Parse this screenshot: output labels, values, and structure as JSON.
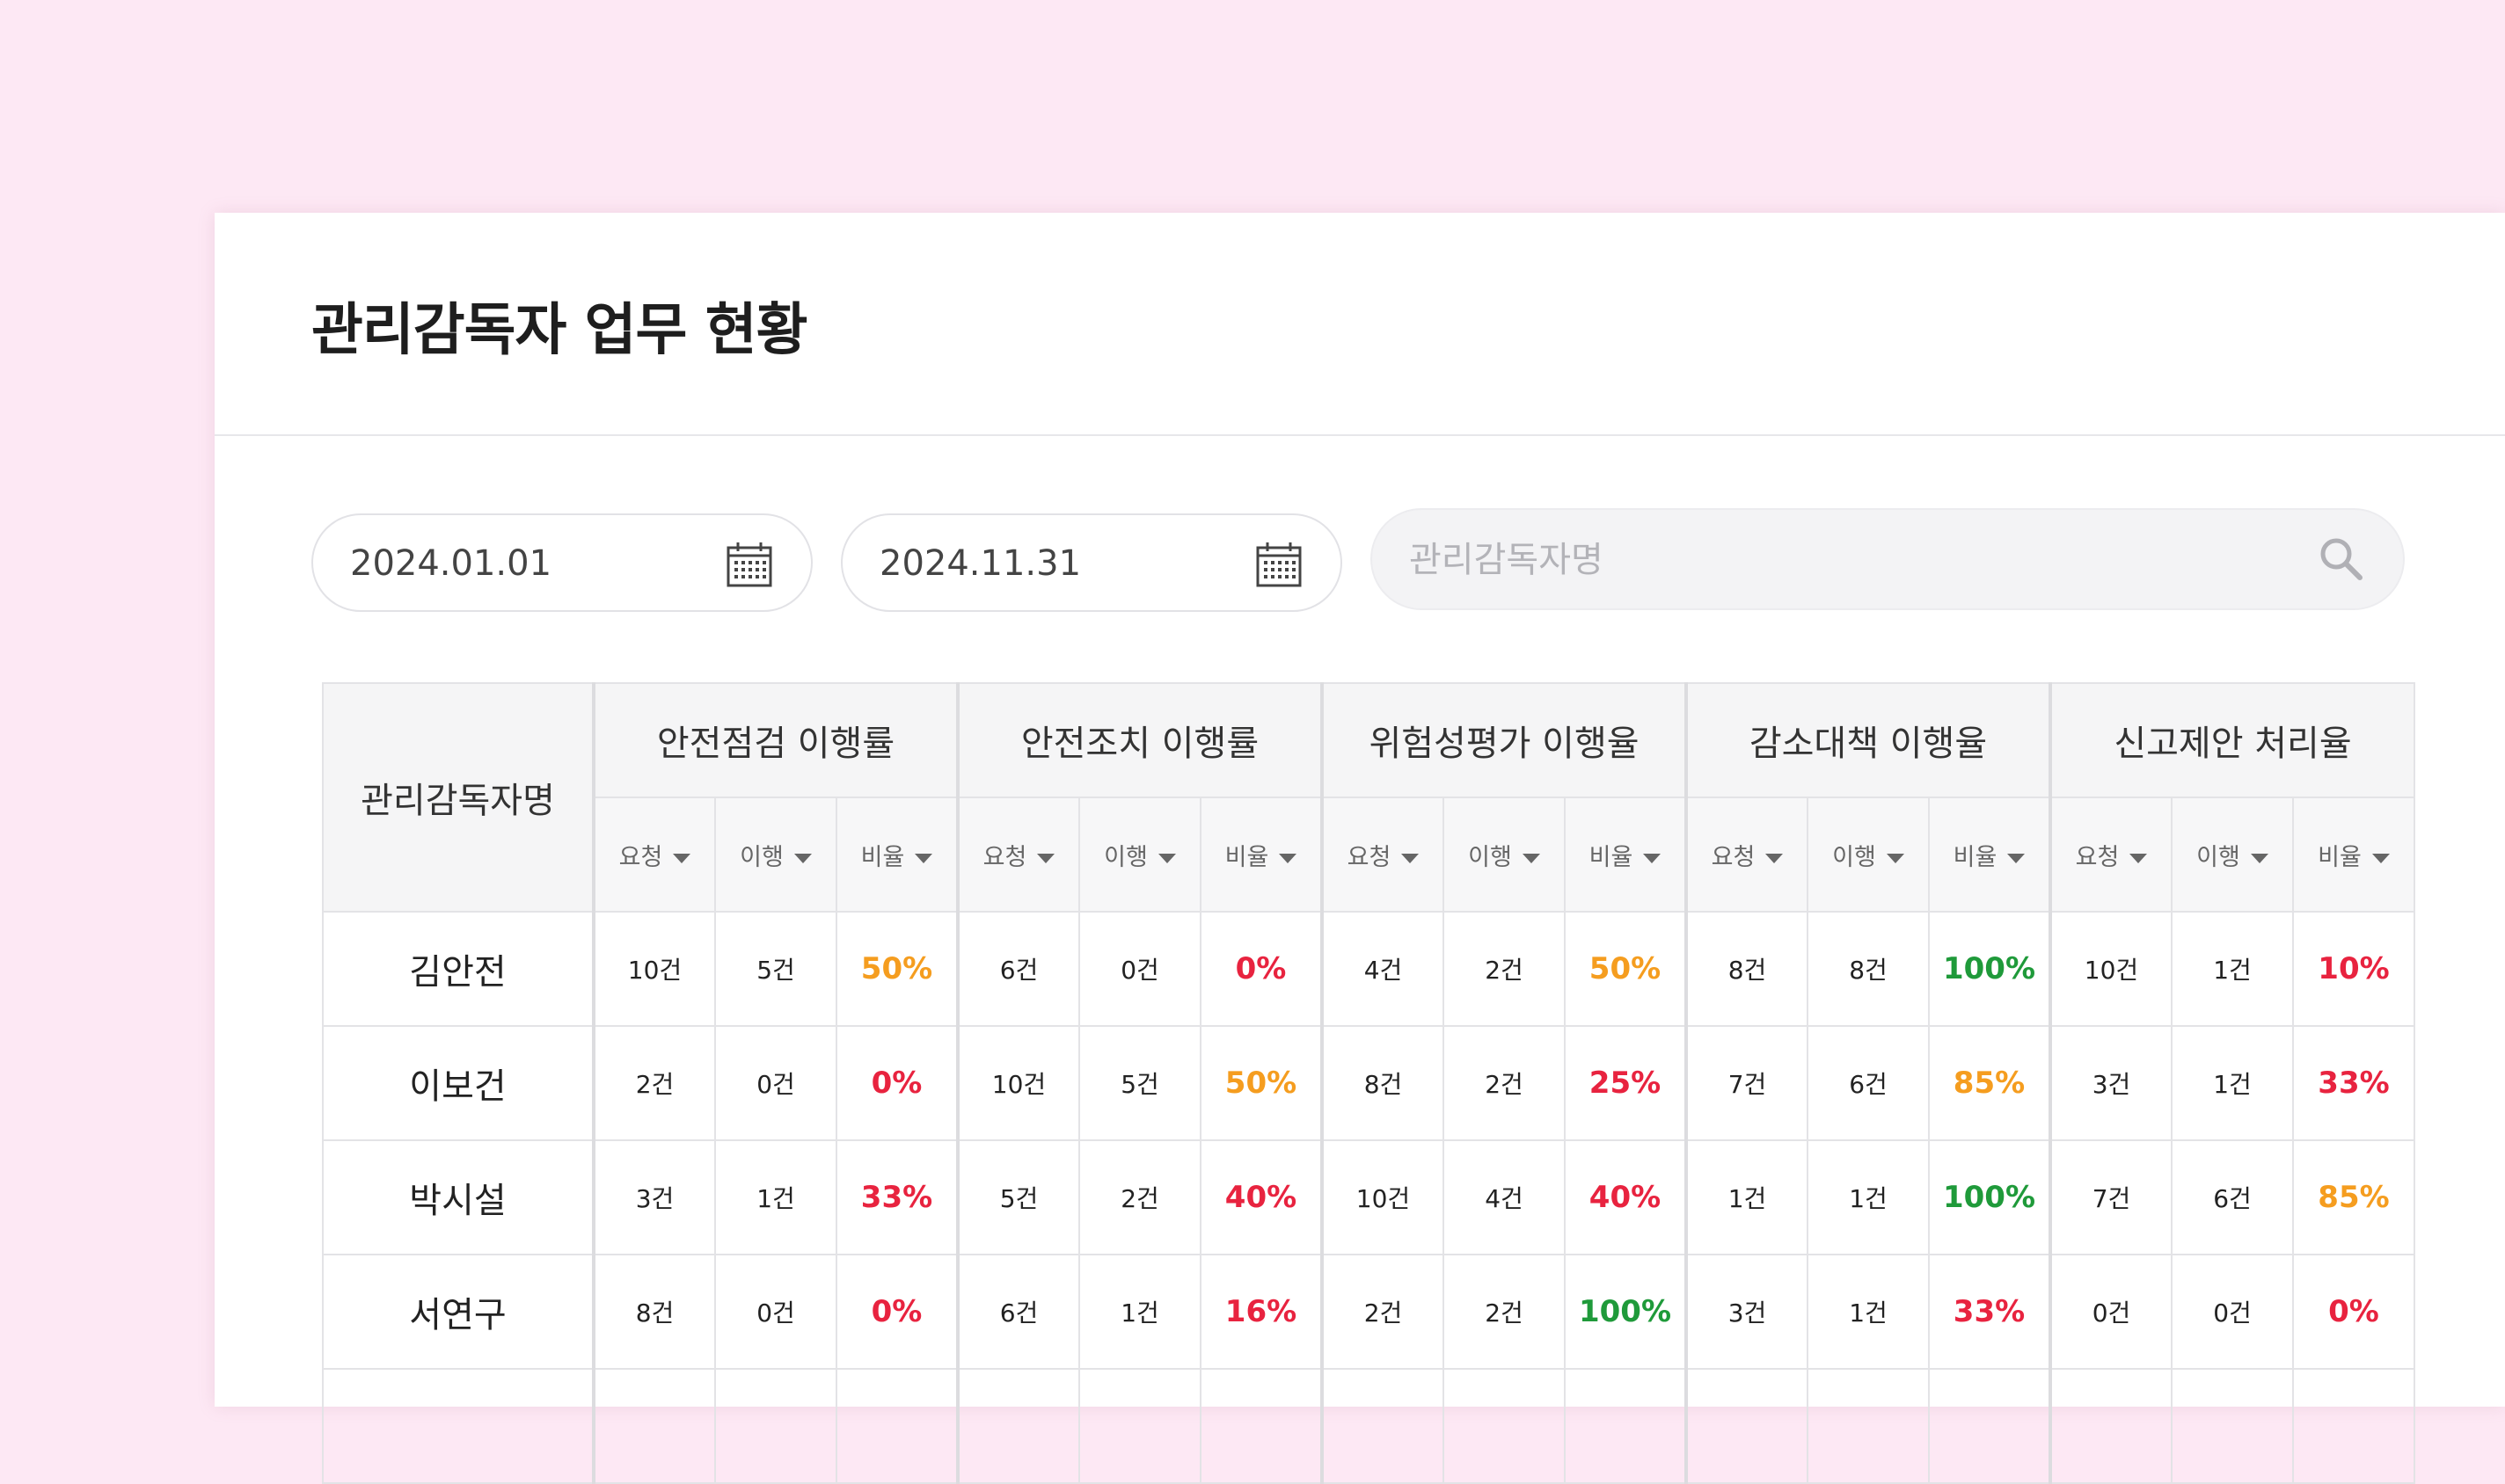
{
  "header": {
    "title": "관리감독자 업무 현황"
  },
  "filters": {
    "start_date": "2024.01.01",
    "end_date": "2024.11.31",
    "search_placeholder": "관리감독자명"
  },
  "table": {
    "name_header": "관리감독자명",
    "groups": [
      "안전점검 이행률",
      "안전조치 이행률",
      "위험성평가 이행율",
      "감소대책 이행율",
      "신고제안 처리율"
    ],
    "sub_headers": [
      "요청",
      "이행",
      "비율"
    ],
    "rows": [
      {
        "name": "김안전",
        "cells": [
          [
            "10건",
            "5건",
            "50%"
          ],
          [
            "6건",
            "0건",
            "0%"
          ],
          [
            "4건",
            "2건",
            "50%"
          ],
          [
            "8건",
            "8건",
            "100%"
          ],
          [
            "10건",
            "1건",
            "10%"
          ]
        ]
      },
      {
        "name": "이보건",
        "cells": [
          [
            "2건",
            "0건",
            "0%"
          ],
          [
            "10건",
            "5건",
            "50%"
          ],
          [
            "8건",
            "2건",
            "25%"
          ],
          [
            "7건",
            "6건",
            "85%"
          ],
          [
            "3건",
            "1건",
            "33%"
          ]
        ]
      },
      {
        "name": "박시설",
        "cells": [
          [
            "3건",
            "1건",
            "33%"
          ],
          [
            "5건",
            "2건",
            "40%"
          ],
          [
            "10건",
            "4건",
            "40%"
          ],
          [
            "1건",
            "1건",
            "100%"
          ],
          [
            "7건",
            "6건",
            "85%"
          ]
        ]
      },
      {
        "name": "서연구",
        "cells": [
          [
            "8건",
            "0건",
            "0%"
          ],
          [
            "6건",
            "1건",
            "16%"
          ],
          [
            "2건",
            "2건",
            "100%"
          ],
          [
            "3건",
            "1건",
            "33%"
          ],
          [
            "0건",
            "0건",
            "0%"
          ]
        ]
      }
    ]
  },
  "colors": {
    "background": "#fde8f4",
    "pct_high": "#1f9a3a",
    "pct_mid": "#f59d1f",
    "pct_low": "#e8233f"
  },
  "icons": {
    "date": "calendar-icon",
    "search": "search-icon",
    "sort": "caret-down-icon"
  }
}
